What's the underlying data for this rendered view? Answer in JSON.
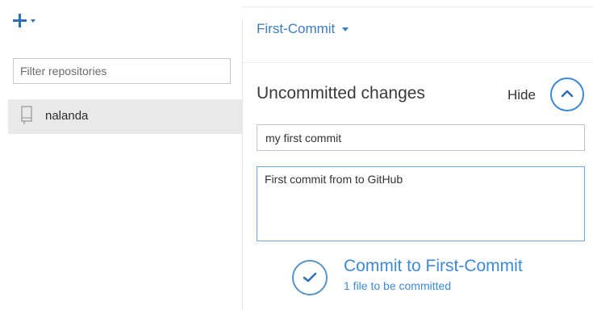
{
  "colors": {
    "accent": "#3d8ad6",
    "brand_blue": "#2f6fb3",
    "selected_bg": "#e9e9e9"
  },
  "sidebar": {
    "add_icon": "plus-icon",
    "filter_placeholder": "Filter repositories",
    "repositories": [
      {
        "label": "nalanda",
        "icon": "repo-icon",
        "selected": true
      }
    ]
  },
  "main": {
    "branch": "First-Commit",
    "section_title": "Uncommitted changes",
    "hide_label": "Hide",
    "commit_summary": "my first commit",
    "commit_description": "First commit from to GitHub",
    "commit_button_label": "Commit to First-Commit",
    "commit_button_sub": "1 file to be committed"
  }
}
